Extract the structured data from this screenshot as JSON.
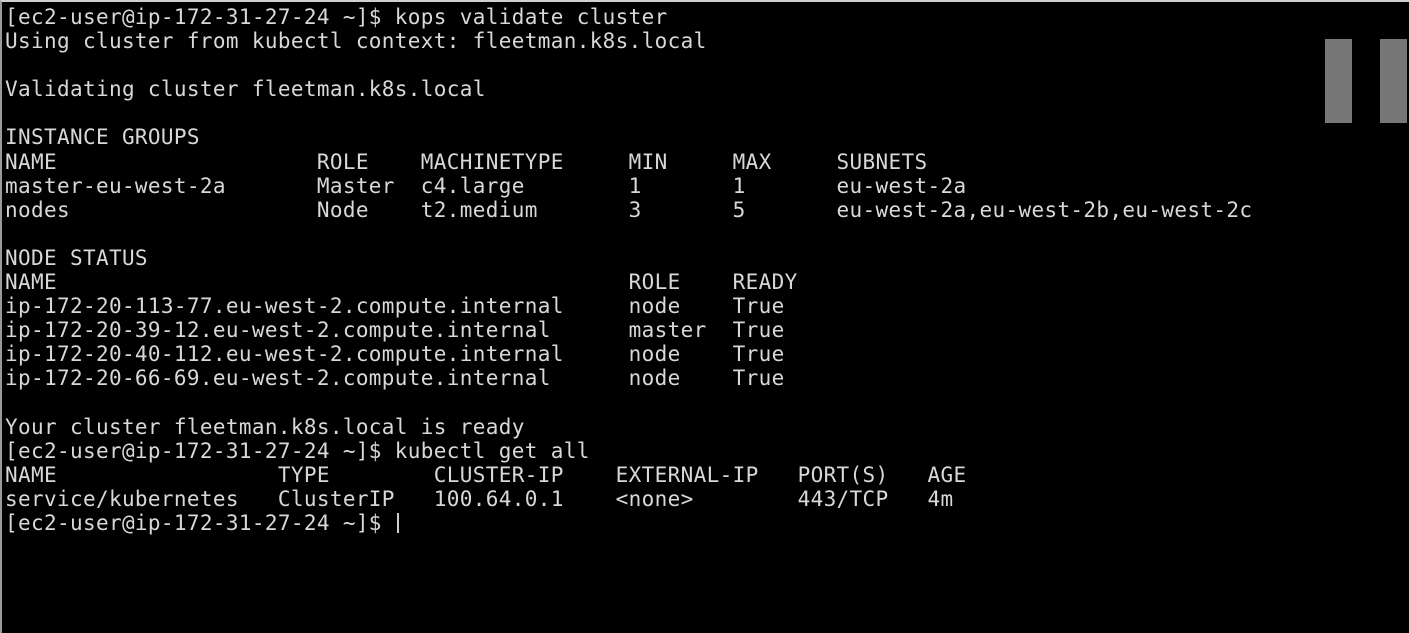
{
  "terminal": {
    "lines": [
      "[ec2-user@ip-172-31-27-24 ~]$ kops validate cluster",
      "Using cluster from kubectl context: fleetman.k8s.local",
      "",
      "Validating cluster fleetman.k8s.local",
      "",
      "INSTANCE GROUPS",
      "NAME                    ROLE    MACHINETYPE     MIN     MAX     SUBNETS",
      "master-eu-west-2a       Master  c4.large        1       1       eu-west-2a",
      "nodes                   Node    t2.medium       3       5       eu-west-2a,eu-west-2b,eu-west-2c",
      "",
      "NODE STATUS",
      "NAME                                            ROLE    READY",
      "ip-172-20-113-77.eu-west-2.compute.internal     node    True",
      "ip-172-20-39-12.eu-west-2.compute.internal      master  True",
      "ip-172-20-40-112.eu-west-2.compute.internal     node    True",
      "ip-172-20-66-69.eu-west-2.compute.internal      node    True",
      "",
      "Your cluster fleetman.k8s.local is ready",
      "[ec2-user@ip-172-31-27-24 ~]$ kubectl get all",
      "NAME                 TYPE        CLUSTER-IP    EXTERNAL-IP   PORT(S)   AGE",
      "service/kubernetes   ClusterIP   100.64.0.1    <none>        443/TCP   4m",
      "[ec2-user@ip-172-31-27-24 ~]$ "
    ],
    "colors": {
      "background": "#000000",
      "text": "#d8d8d8",
      "overlay": "#777777"
    }
  },
  "overlay": {
    "icon": "pause-icon"
  }
}
